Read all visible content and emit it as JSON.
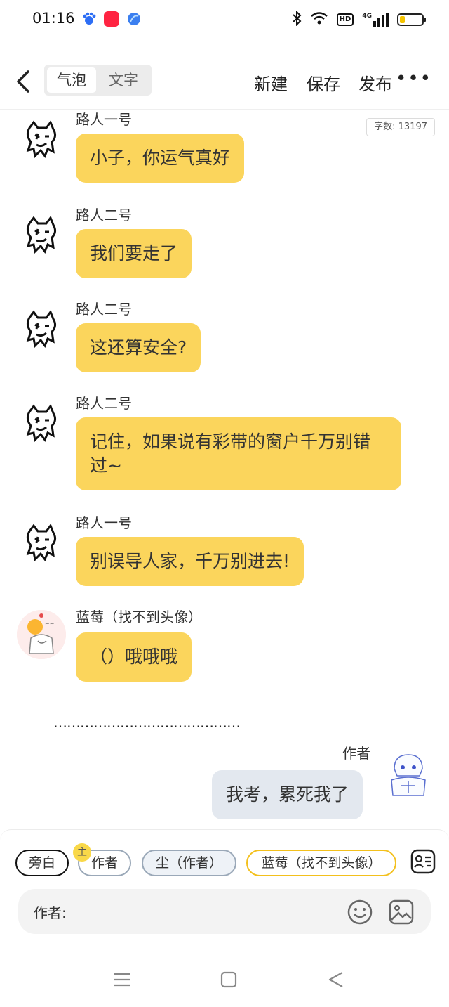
{
  "status_bar": {
    "time": "01:16",
    "app_icons": [
      {
        "name": "baidu-app-icon",
        "color": "#2d6ef5"
      },
      {
        "name": "xiaohongshu-app-icon",
        "color": "#ff2442"
      },
      {
        "name": "browser-app-icon",
        "color": "#3b7ff0"
      }
    ],
    "hd_label": "HD",
    "network_label": "4G",
    "battery_level": 0.15,
    "battery_color": "#f5c400"
  },
  "nav": {
    "mode_tabs": [
      "气泡",
      "文字"
    ],
    "active_mode": "气泡",
    "actions": {
      "new": "新建",
      "save": "保存",
      "publish": "发布"
    },
    "more_glyph": "•••"
  },
  "word_count": "字数: 13197",
  "messages": [
    {
      "name": "路人一号",
      "text": "小子，你运气真好",
      "side": "left",
      "avatar": "cat-doodle-avatar"
    },
    {
      "name": "路人二号",
      "text": "我们要走了",
      "side": "left",
      "avatar": "cat-doodle-avatar"
    },
    {
      "name": "路人二号",
      "text": "这还算安全?",
      "side": "left",
      "avatar": "cat-doodle-avatar"
    },
    {
      "name": "路人二号",
      "text": "记住，如果说有彩带的窗户千万别错过~",
      "side": "left",
      "avatar": "cat-doodle-avatar"
    },
    {
      "name": "路人一号",
      "text": "别误导人家，千万别进去!",
      "side": "left",
      "avatar": "cat-doodle-avatar"
    },
    {
      "name": "蓝莓（找不到头像）",
      "text": "（）哦哦哦",
      "side": "left",
      "avatar": "sketch-avatar"
    },
    {
      "name": "作者",
      "text": "我考，累死我了",
      "side": "right",
      "avatar": "anime-avatar"
    }
  ],
  "divider_text": "……………………………………",
  "colors": {
    "bubble_left": "#fbd55c",
    "bubble_right": "#e3e8ef",
    "accent": "#f3c01d"
  },
  "roles": {
    "chips": [
      "旁白",
      "作者",
      "尘（作者）",
      "蓝莓（找不到头像）"
    ],
    "main_badge": "主"
  },
  "input": {
    "speaker_label": "作者:"
  }
}
